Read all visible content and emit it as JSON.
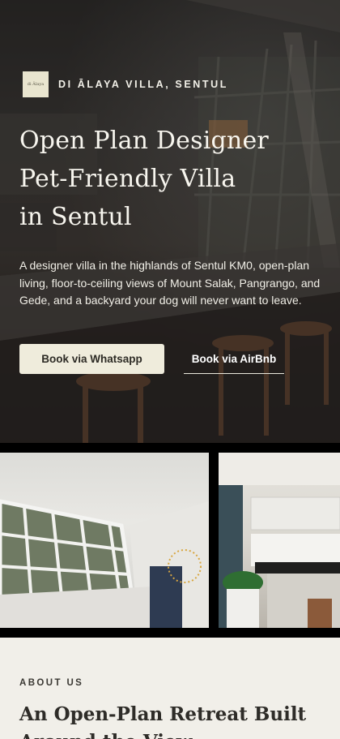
{
  "brand": {
    "logo_text": "di Ālaya",
    "name": "DI ĀLAYA VILLA, SENTUL"
  },
  "hero": {
    "title_lines": [
      "Open Plan Designer",
      "Pet-Friendly Villa",
      "in Sentul"
    ],
    "description": "A designer villa in the highlands of Sentul KM0, open-plan living, floor-to-ceiling views of Mount Salak, Pangrango, and Gede, and a backyard your dog will never want to leave.",
    "whatsapp_button": "Book via Whatsapp",
    "airbnb_button": "Book via AirBnb"
  },
  "gallery": {
    "photos": [
      "bedroom-photo",
      "kitchen-photo"
    ]
  },
  "about": {
    "label": "ABOUT US",
    "title": "An Open-Plan Retreat Built Around the View"
  },
  "colors": {
    "button_bg": "#efecdc",
    "about_bg": "#f1efe9",
    "text_dark": "#2b2a26"
  }
}
